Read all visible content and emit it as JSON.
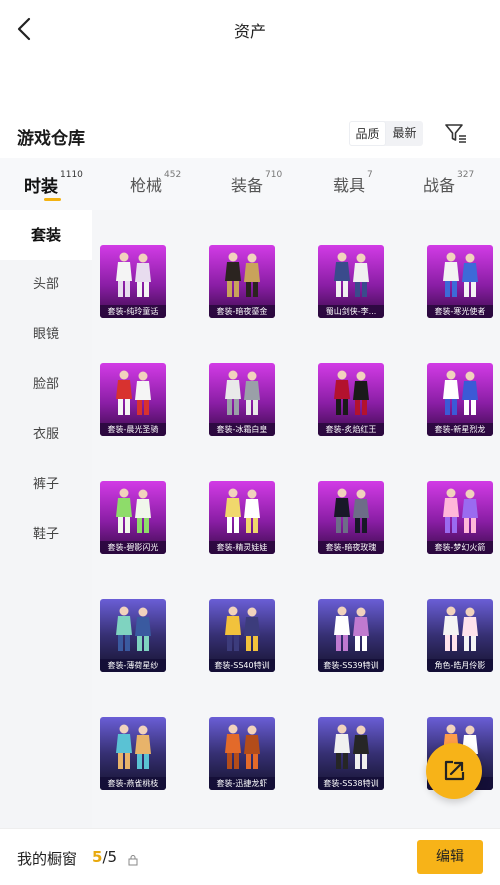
{
  "header": {
    "title": "资产"
  },
  "section": {
    "title": "游戏仓库"
  },
  "sort": {
    "quality": "品质",
    "latest": "最新"
  },
  "tabs": [
    {
      "label": "时装",
      "count": "1110"
    },
    {
      "label": "枪械",
      "count": "452"
    },
    {
      "label": "装备",
      "count": "710"
    },
    {
      "label": "载具",
      "count": "7"
    },
    {
      "label": "战备",
      "count": "327"
    }
  ],
  "sidebar": {
    "items": [
      "套装",
      "头部",
      "眼镜",
      "脸部",
      "衣服",
      "裤子",
      "鞋子"
    ]
  },
  "items": [
    {
      "name": "套装-纯玲童话",
      "rarity": "purple"
    },
    {
      "name": "套装-暗夜鎏金",
      "rarity": "purple"
    },
    {
      "name": "蜀山剑侠-李...",
      "rarity": "purple"
    },
    {
      "name": "套装-寒光使者",
      "rarity": "purple"
    },
    {
      "name": "套装-晨光圣骑",
      "rarity": "purple"
    },
    {
      "name": "套装-冰霜白皇",
      "rarity": "purple"
    },
    {
      "name": "套装-炙焰红王",
      "rarity": "purple"
    },
    {
      "name": "套装-新星烈龙",
      "rarity": "purple"
    },
    {
      "name": "套装-碧影闪光",
      "rarity": "purple"
    },
    {
      "name": "套装-精灵娃娃",
      "rarity": "purple"
    },
    {
      "name": "套装-暗夜玫瑰",
      "rarity": "purple"
    },
    {
      "name": "套装-梦幻火箭",
      "rarity": "purple"
    },
    {
      "name": "套装-薄荷星纱",
      "rarity": "blue"
    },
    {
      "name": "套装-SS40特训",
      "rarity": "blue"
    },
    {
      "name": "套装-SS39特训",
      "rarity": "blue"
    },
    {
      "name": "角色-皓月伶影",
      "rarity": "blue"
    },
    {
      "name": "套装-燕雀桃枝",
      "rarity": "blue"
    },
    {
      "name": "套装-迅捷龙虾",
      "rarity": "blue"
    },
    {
      "name": "套装-SS38特训",
      "rarity": "blue"
    },
    {
      "name": "套装-",
      "rarity": "blue"
    }
  ],
  "showcase": {
    "label": "我的橱窗",
    "current": "5",
    "total": "/5"
  },
  "edit_button": "编辑",
  "colors": {
    "accent": "#f7b318",
    "purple_tier": "#b02bc9",
    "blue_tier": "#4a42a3"
  },
  "icons": {
    "back": "chevron-left-icon",
    "filter": "filter-icon",
    "share": "share-external-icon",
    "lock": "lock-icon"
  }
}
